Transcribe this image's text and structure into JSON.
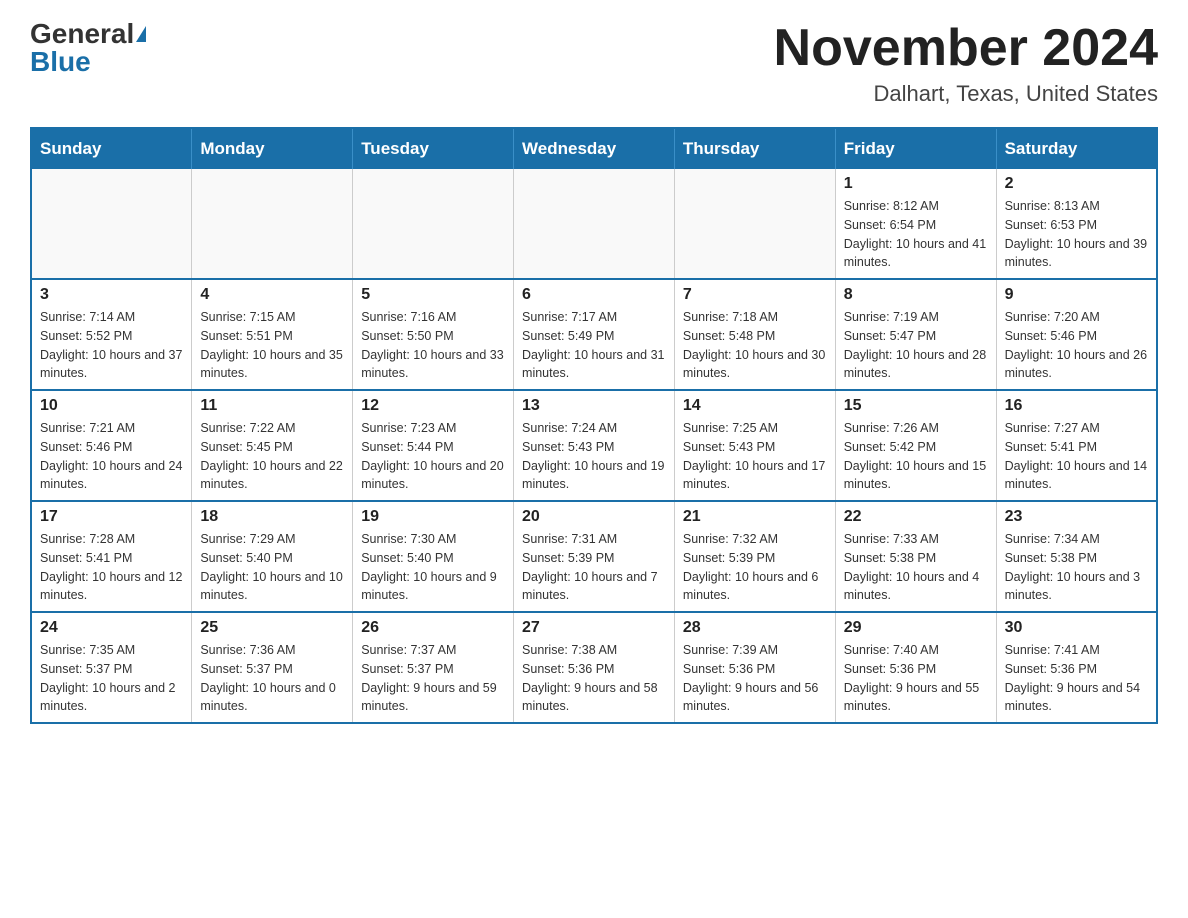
{
  "header": {
    "logo_general": "General",
    "logo_blue": "Blue",
    "month_title": "November 2024",
    "location": "Dalhart, Texas, United States"
  },
  "days_of_week": [
    "Sunday",
    "Monday",
    "Tuesday",
    "Wednesday",
    "Thursday",
    "Friday",
    "Saturday"
  ],
  "weeks": [
    [
      {
        "day": "",
        "info": ""
      },
      {
        "day": "",
        "info": ""
      },
      {
        "day": "",
        "info": ""
      },
      {
        "day": "",
        "info": ""
      },
      {
        "day": "",
        "info": ""
      },
      {
        "day": "1",
        "info": "Sunrise: 8:12 AM\nSunset: 6:54 PM\nDaylight: 10 hours and 41 minutes."
      },
      {
        "day": "2",
        "info": "Sunrise: 8:13 AM\nSunset: 6:53 PM\nDaylight: 10 hours and 39 minutes."
      }
    ],
    [
      {
        "day": "3",
        "info": "Sunrise: 7:14 AM\nSunset: 5:52 PM\nDaylight: 10 hours and 37 minutes."
      },
      {
        "day": "4",
        "info": "Sunrise: 7:15 AM\nSunset: 5:51 PM\nDaylight: 10 hours and 35 minutes."
      },
      {
        "day": "5",
        "info": "Sunrise: 7:16 AM\nSunset: 5:50 PM\nDaylight: 10 hours and 33 minutes."
      },
      {
        "day": "6",
        "info": "Sunrise: 7:17 AM\nSunset: 5:49 PM\nDaylight: 10 hours and 31 minutes."
      },
      {
        "day": "7",
        "info": "Sunrise: 7:18 AM\nSunset: 5:48 PM\nDaylight: 10 hours and 30 minutes."
      },
      {
        "day": "8",
        "info": "Sunrise: 7:19 AM\nSunset: 5:47 PM\nDaylight: 10 hours and 28 minutes."
      },
      {
        "day": "9",
        "info": "Sunrise: 7:20 AM\nSunset: 5:46 PM\nDaylight: 10 hours and 26 minutes."
      }
    ],
    [
      {
        "day": "10",
        "info": "Sunrise: 7:21 AM\nSunset: 5:46 PM\nDaylight: 10 hours and 24 minutes."
      },
      {
        "day": "11",
        "info": "Sunrise: 7:22 AM\nSunset: 5:45 PM\nDaylight: 10 hours and 22 minutes."
      },
      {
        "day": "12",
        "info": "Sunrise: 7:23 AM\nSunset: 5:44 PM\nDaylight: 10 hours and 20 minutes."
      },
      {
        "day": "13",
        "info": "Sunrise: 7:24 AM\nSunset: 5:43 PM\nDaylight: 10 hours and 19 minutes."
      },
      {
        "day": "14",
        "info": "Sunrise: 7:25 AM\nSunset: 5:43 PM\nDaylight: 10 hours and 17 minutes."
      },
      {
        "day": "15",
        "info": "Sunrise: 7:26 AM\nSunset: 5:42 PM\nDaylight: 10 hours and 15 minutes."
      },
      {
        "day": "16",
        "info": "Sunrise: 7:27 AM\nSunset: 5:41 PM\nDaylight: 10 hours and 14 minutes."
      }
    ],
    [
      {
        "day": "17",
        "info": "Sunrise: 7:28 AM\nSunset: 5:41 PM\nDaylight: 10 hours and 12 minutes."
      },
      {
        "day": "18",
        "info": "Sunrise: 7:29 AM\nSunset: 5:40 PM\nDaylight: 10 hours and 10 minutes."
      },
      {
        "day": "19",
        "info": "Sunrise: 7:30 AM\nSunset: 5:40 PM\nDaylight: 10 hours and 9 minutes."
      },
      {
        "day": "20",
        "info": "Sunrise: 7:31 AM\nSunset: 5:39 PM\nDaylight: 10 hours and 7 minutes."
      },
      {
        "day": "21",
        "info": "Sunrise: 7:32 AM\nSunset: 5:39 PM\nDaylight: 10 hours and 6 minutes."
      },
      {
        "day": "22",
        "info": "Sunrise: 7:33 AM\nSunset: 5:38 PM\nDaylight: 10 hours and 4 minutes."
      },
      {
        "day": "23",
        "info": "Sunrise: 7:34 AM\nSunset: 5:38 PM\nDaylight: 10 hours and 3 minutes."
      }
    ],
    [
      {
        "day": "24",
        "info": "Sunrise: 7:35 AM\nSunset: 5:37 PM\nDaylight: 10 hours and 2 minutes."
      },
      {
        "day": "25",
        "info": "Sunrise: 7:36 AM\nSunset: 5:37 PM\nDaylight: 10 hours and 0 minutes."
      },
      {
        "day": "26",
        "info": "Sunrise: 7:37 AM\nSunset: 5:37 PM\nDaylight: 9 hours and 59 minutes."
      },
      {
        "day": "27",
        "info": "Sunrise: 7:38 AM\nSunset: 5:36 PM\nDaylight: 9 hours and 58 minutes."
      },
      {
        "day": "28",
        "info": "Sunrise: 7:39 AM\nSunset: 5:36 PM\nDaylight: 9 hours and 56 minutes."
      },
      {
        "day": "29",
        "info": "Sunrise: 7:40 AM\nSunset: 5:36 PM\nDaylight: 9 hours and 55 minutes."
      },
      {
        "day": "30",
        "info": "Sunrise: 7:41 AM\nSunset: 5:36 PM\nDaylight: 9 hours and 54 minutes."
      }
    ]
  ]
}
